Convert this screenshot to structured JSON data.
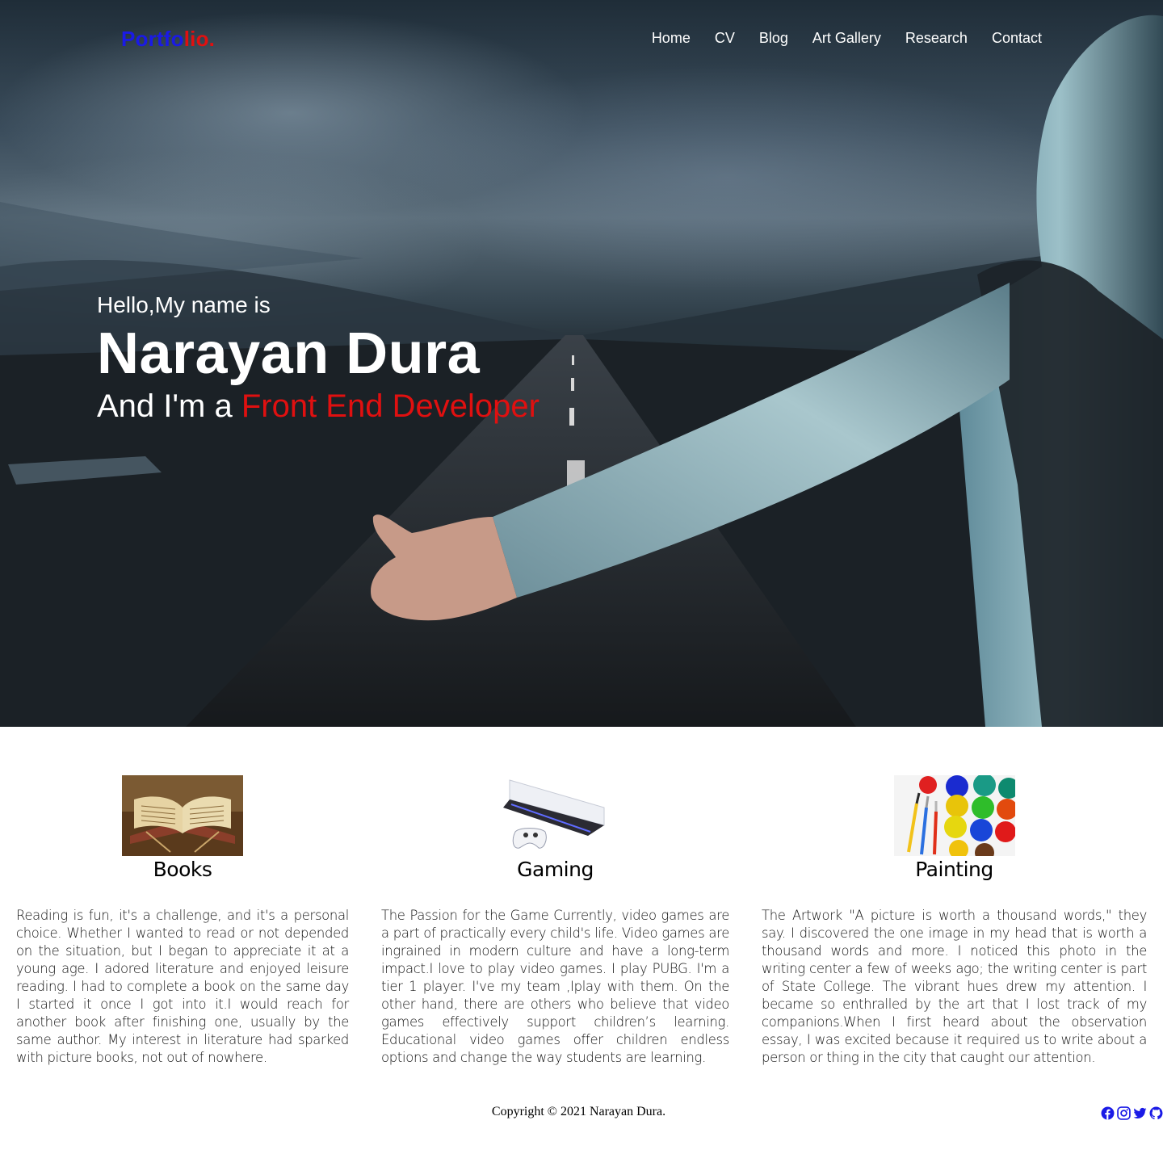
{
  "nav": {
    "logo_primary": "Portfo",
    "logo_accent": "lio.",
    "items": [
      "Home",
      "CV",
      "Blog",
      "Art Gallery",
      "Research",
      "Contact"
    ]
  },
  "hero": {
    "greeting": "Hello,My name is",
    "name": "Narayan Dura",
    "role_prefix": "And I'm a ",
    "role_highlight": "Front End Developer"
  },
  "hobbies": [
    {
      "title": "Books",
      "image": "open-book-image",
      "text": "Reading is fun, it's a challenge, and it's a personal choice. Whether I wanted to read or not depended on the situation, but I began to appreciate it at a young age. I adored literature and enjoyed leisure reading. I had to complete a book on the same day I started it once I got into it.I would reach for another book after finishing one, usually by the same author. My interest in literature had sparked with picture books, not out of nowhere."
    },
    {
      "title": "Gaming",
      "image": "game-console-image",
      "text": "The Passion for the Game Currently, video games are a part of practically every child's life. Video games are ingrained in modern culture and have a long-term impact.I love to play video games. I play PUBG. I'm a tier 1 player. I've my team ,Iplay with them. On the other hand, there are others who believe that video games effectively support children’s learning. Educational video games offer children endless options and change the way students are learning."
    },
    {
      "title": "Painting",
      "image": "paint-palette-image",
      "text": "The Artwork \"A picture is worth a thousand words,\" they say. I discovered the one image in my head that is worth a thousand words and more. I noticed this photo in the writing center a few of weeks ago; the writing center is part of State College. The vibrant hues drew my attention. I became so enthralled by the art that I lost track of my companions.When I first heard about the observation essay, I was excited because it required us to write about a person or thing in the city that caught our attention."
    }
  ],
  "footer": {
    "copyright": "Copyright © 2021 Narayan Dura.",
    "social_icons": [
      "facebook-icon",
      "instagram-icon",
      "twitter-icon",
      "github-icon"
    ]
  },
  "colors": {
    "logo_primary": "#1a1ae6",
    "accent_red": "#e01010",
    "nav_text": "#ffffff",
    "social_blue": "#1a1ae6"
  }
}
